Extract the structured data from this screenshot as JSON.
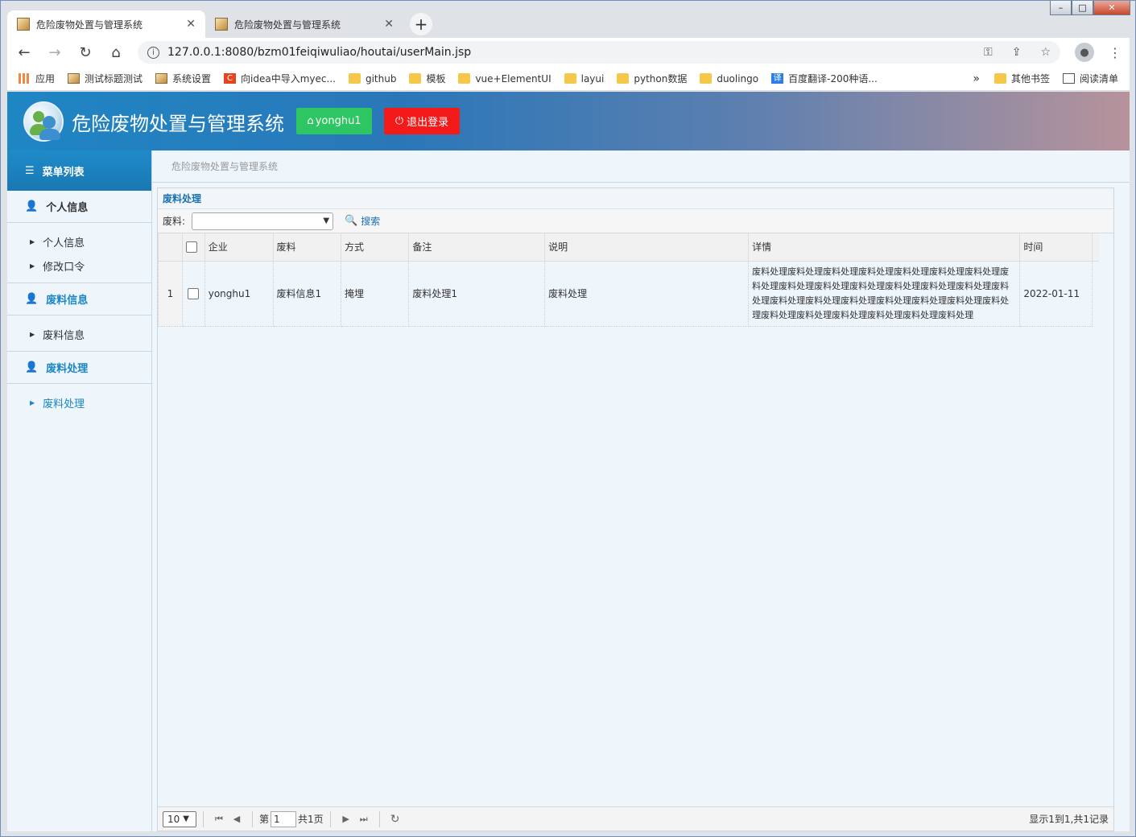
{
  "browser": {
    "tabs": [
      {
        "title": "危险废物处置与管理系统",
        "active": true
      },
      {
        "title": "危险废物处置与管理系统",
        "active": false
      }
    ],
    "url": "127.0.0.1:8080/bzm01feiqiwuliao/houtai/userMain.jsp",
    "bookmarks": [
      {
        "label": "应用",
        "icon": "apps-grid-icon"
      },
      {
        "label": "测试标题测试",
        "icon": "page-icon"
      },
      {
        "label": "系统设置",
        "icon": "page-icon"
      },
      {
        "label": "向idea中导入myec...",
        "icon": "c-icon"
      },
      {
        "label": "github",
        "icon": "folder-icon"
      },
      {
        "label": "模板",
        "icon": "folder-icon"
      },
      {
        "label": "vue+ElementUI",
        "icon": "folder-icon"
      },
      {
        "label": "layui",
        "icon": "folder-icon"
      },
      {
        "label": "python数据",
        "icon": "folder-icon"
      },
      {
        "label": "duolingo",
        "icon": "folder-icon"
      },
      {
        "label": "百度翻译-200种语...",
        "icon": "translate-icon"
      }
    ],
    "bookmarks_more": "»",
    "other_bookmarks": "其他书签",
    "reading_list": "阅读清单"
  },
  "header": {
    "title": "危险废物处置与管理系统",
    "user_label": "yonghu1",
    "logout_label": "退出登录"
  },
  "sidebar": {
    "heading": "菜单列表",
    "groups": [
      {
        "label": "个人信息",
        "items": [
          "个人信息",
          "修改口令"
        ]
      },
      {
        "label": "废料信息",
        "items": [
          "废料信息"
        ]
      },
      {
        "label": "废料处理",
        "items": [
          "废料处理"
        ]
      }
    ]
  },
  "breadcrumb": "危险废物处置与管理系统",
  "panel": {
    "title": "废料处理",
    "filter_label": "废料:",
    "filter_value": "",
    "search_label": "搜索",
    "columns": [
      "企业",
      "废料",
      "方式",
      "备注",
      "说明",
      "详情",
      "时间"
    ],
    "rows": [
      {
        "num": "1",
        "company": "yonghu1",
        "material": "废料信息1",
        "method": "掩埋",
        "remark": "废料处理1",
        "explain": "废料处理",
        "detail": "废料处理废料处理废料处理废料处理废料处理废料处理废料处理废料处理废料处理废料处理废料处理废料处理废料处理废料处理废料处理废料处理废料处理废料处理废料处理废料处理废料处理废料处理废料处理废料处理废料处理废料处理废料处理废料处理",
        "time": "2022-01-11"
      }
    ]
  },
  "pager": {
    "page_size": "10",
    "page_prefix": "第",
    "page_number": "1",
    "page_suffix": "共1页",
    "summary": "显示1到1,共1记录"
  }
}
